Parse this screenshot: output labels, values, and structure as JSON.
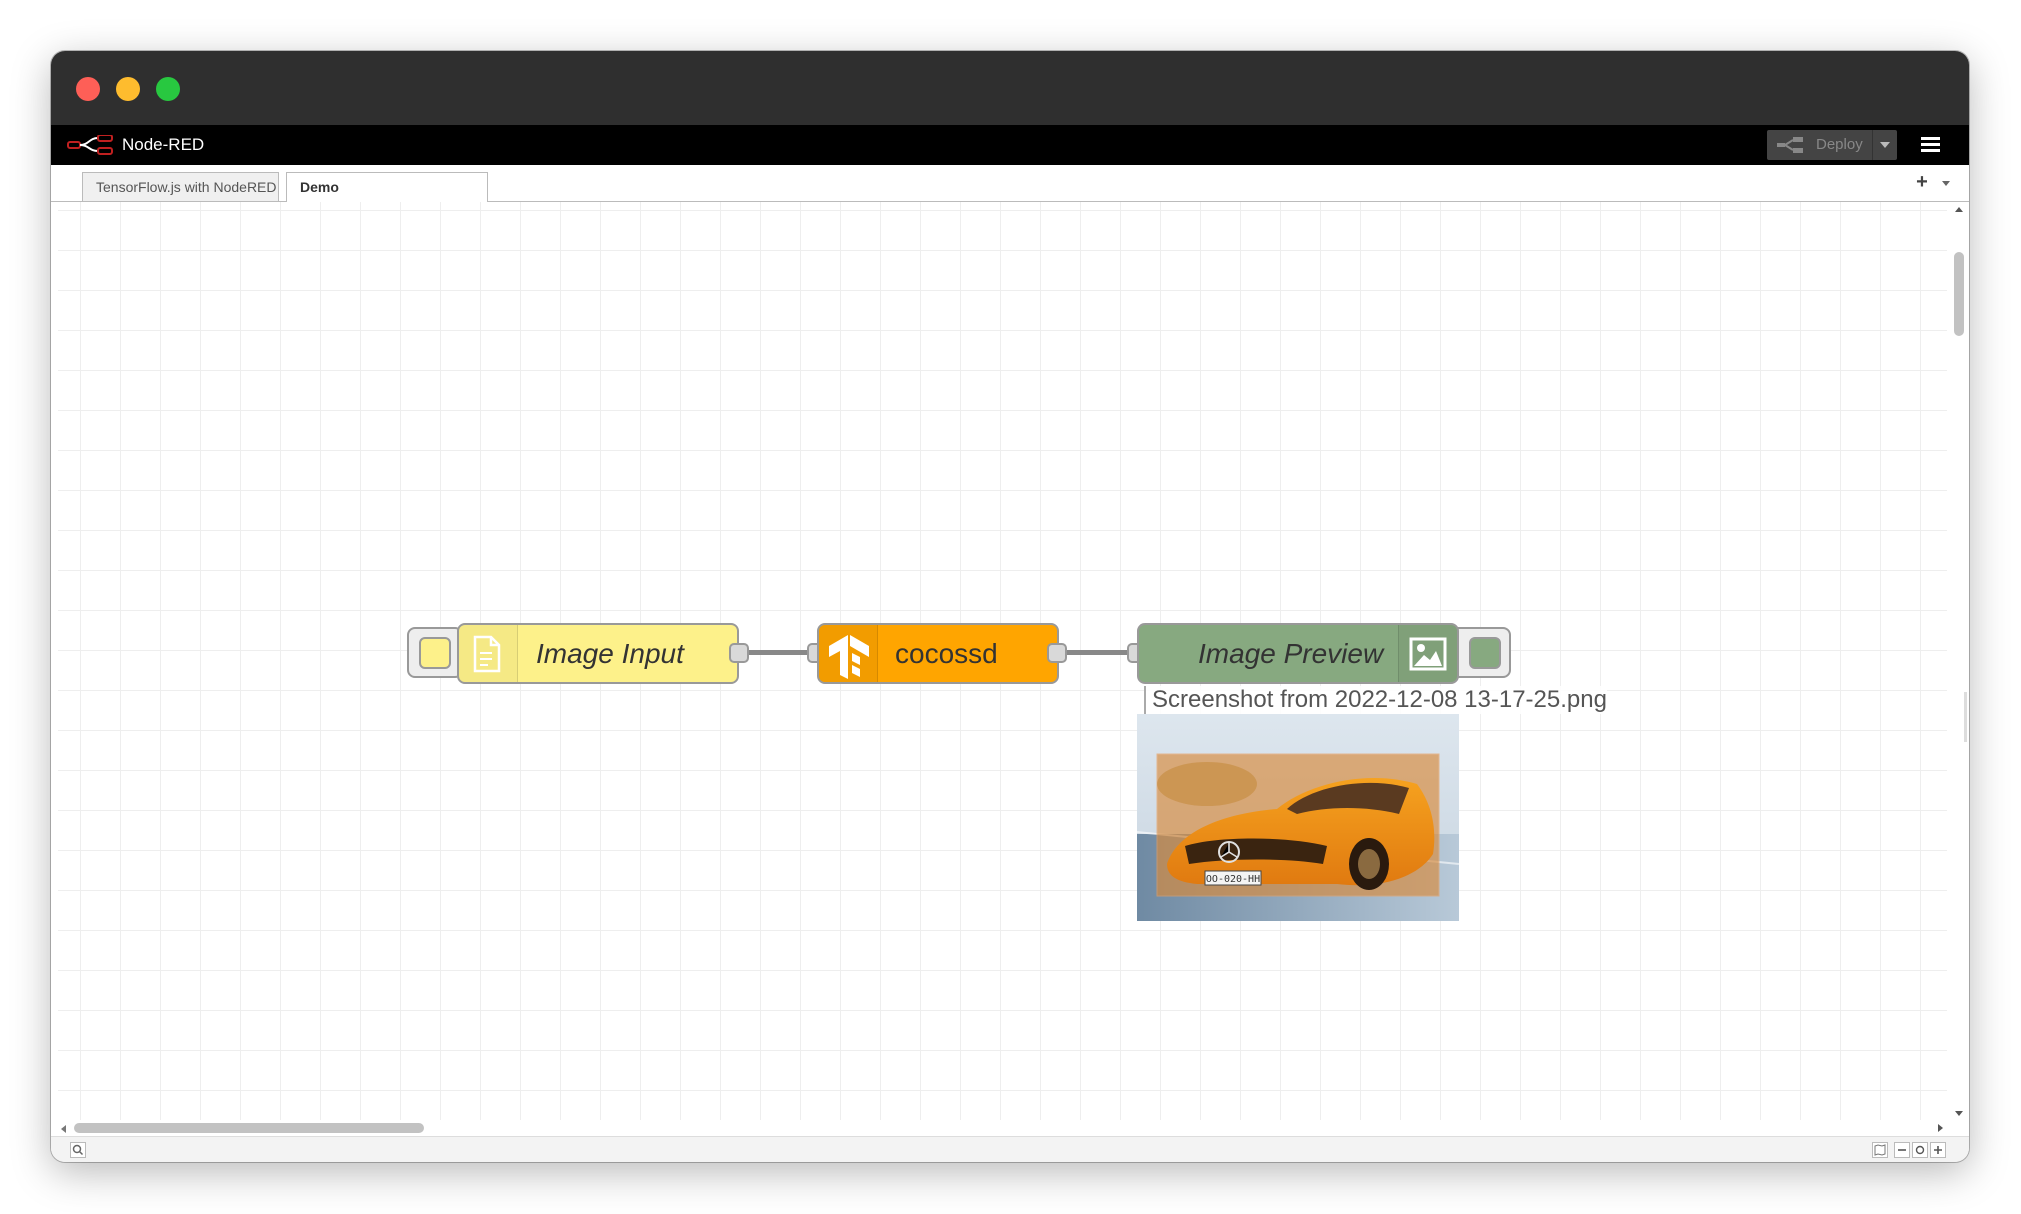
{
  "app": {
    "title": "Node-RED",
    "deploy_label": "Deploy"
  },
  "tabs": [
    {
      "label": "TensorFlow.js with NodeRED",
      "active": false
    },
    {
      "label": "Demo",
      "active": true
    }
  ],
  "nodes": {
    "image_input": {
      "label": "Image Input",
      "color": "#fdf18a"
    },
    "cocossd": {
      "label": "cocossd",
      "color": "#ffa500"
    },
    "image_preview": {
      "label": "Image Preview",
      "color": "#87a980"
    }
  },
  "preview": {
    "filename": "Screenshot from 2022-12-08 13-17-25.png",
    "plate_text": "OO-020-HH"
  },
  "icons": [
    "logo-icon",
    "deploy-icon",
    "menu-icon",
    "add-tab-icon",
    "tab-menu-icon",
    "file-icon",
    "tensorflow-icon",
    "image-icon",
    "search-icon",
    "map-icon",
    "zoom-out-icon",
    "zoom-reset-icon",
    "zoom-in-icon"
  ]
}
